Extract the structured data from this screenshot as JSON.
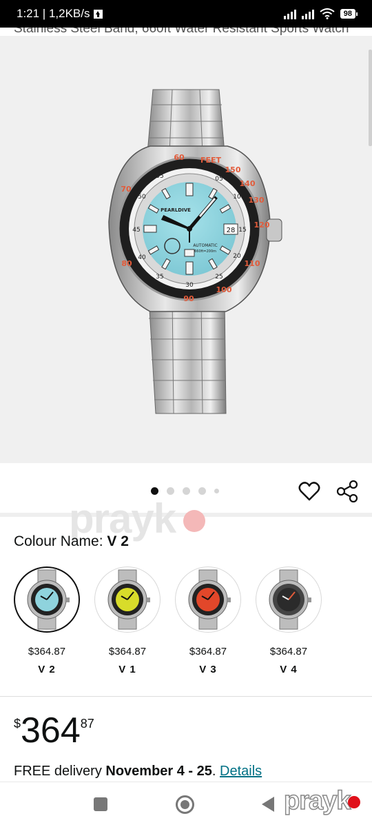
{
  "status_bar": {
    "time_speed": "1:21 | 1,2KB/s",
    "battery": "98"
  },
  "product": {
    "title_cut": "Stainless Steel Band, 660ft Water Resistant Sports Watch",
    "colour_label": "Colour Name:",
    "colour_value": "V 2",
    "image_count": 5,
    "active_image": 1
  },
  "swatches": [
    {
      "price": "$364.87",
      "name": "V 2",
      "dial_color": "#8fd3dd",
      "selected": true
    },
    {
      "price": "$364.87",
      "name": "V 1",
      "dial_color": "#d8dc2a",
      "selected": false
    },
    {
      "price": "$364.87",
      "name": "V 3",
      "dial_color": "#e2472a",
      "selected": false
    },
    {
      "price": "$364.87",
      "name": "V 4",
      "dial_color": "#2b2b2b",
      "selected": false
    }
  ],
  "price": {
    "currency": "$",
    "whole": "364",
    "fraction": "87"
  },
  "delivery": {
    "prefix": "FREE delivery",
    "dates": "November 4 - 25",
    "separator": ".",
    "link": "Details"
  },
  "watermark": {
    "text": "prayk",
    "logo_text": "prayk",
    "logo_color": "#e0101a"
  },
  "watch": {
    "brand": "PEARLDIVE",
    "movement": "AUTOMATIC",
    "depth": "660ft=200m",
    "date": "28",
    "bezel_word": "FEET",
    "bezel_numbers": [
      "60",
      "150",
      "140",
      "130",
      "120",
      "110",
      "100",
      "90",
      "80",
      "70"
    ],
    "dial_numbers": [
      "05",
      "10",
      "15",
      "20",
      "25",
      "30",
      "35",
      "40",
      "45",
      "50",
      "55"
    ]
  }
}
